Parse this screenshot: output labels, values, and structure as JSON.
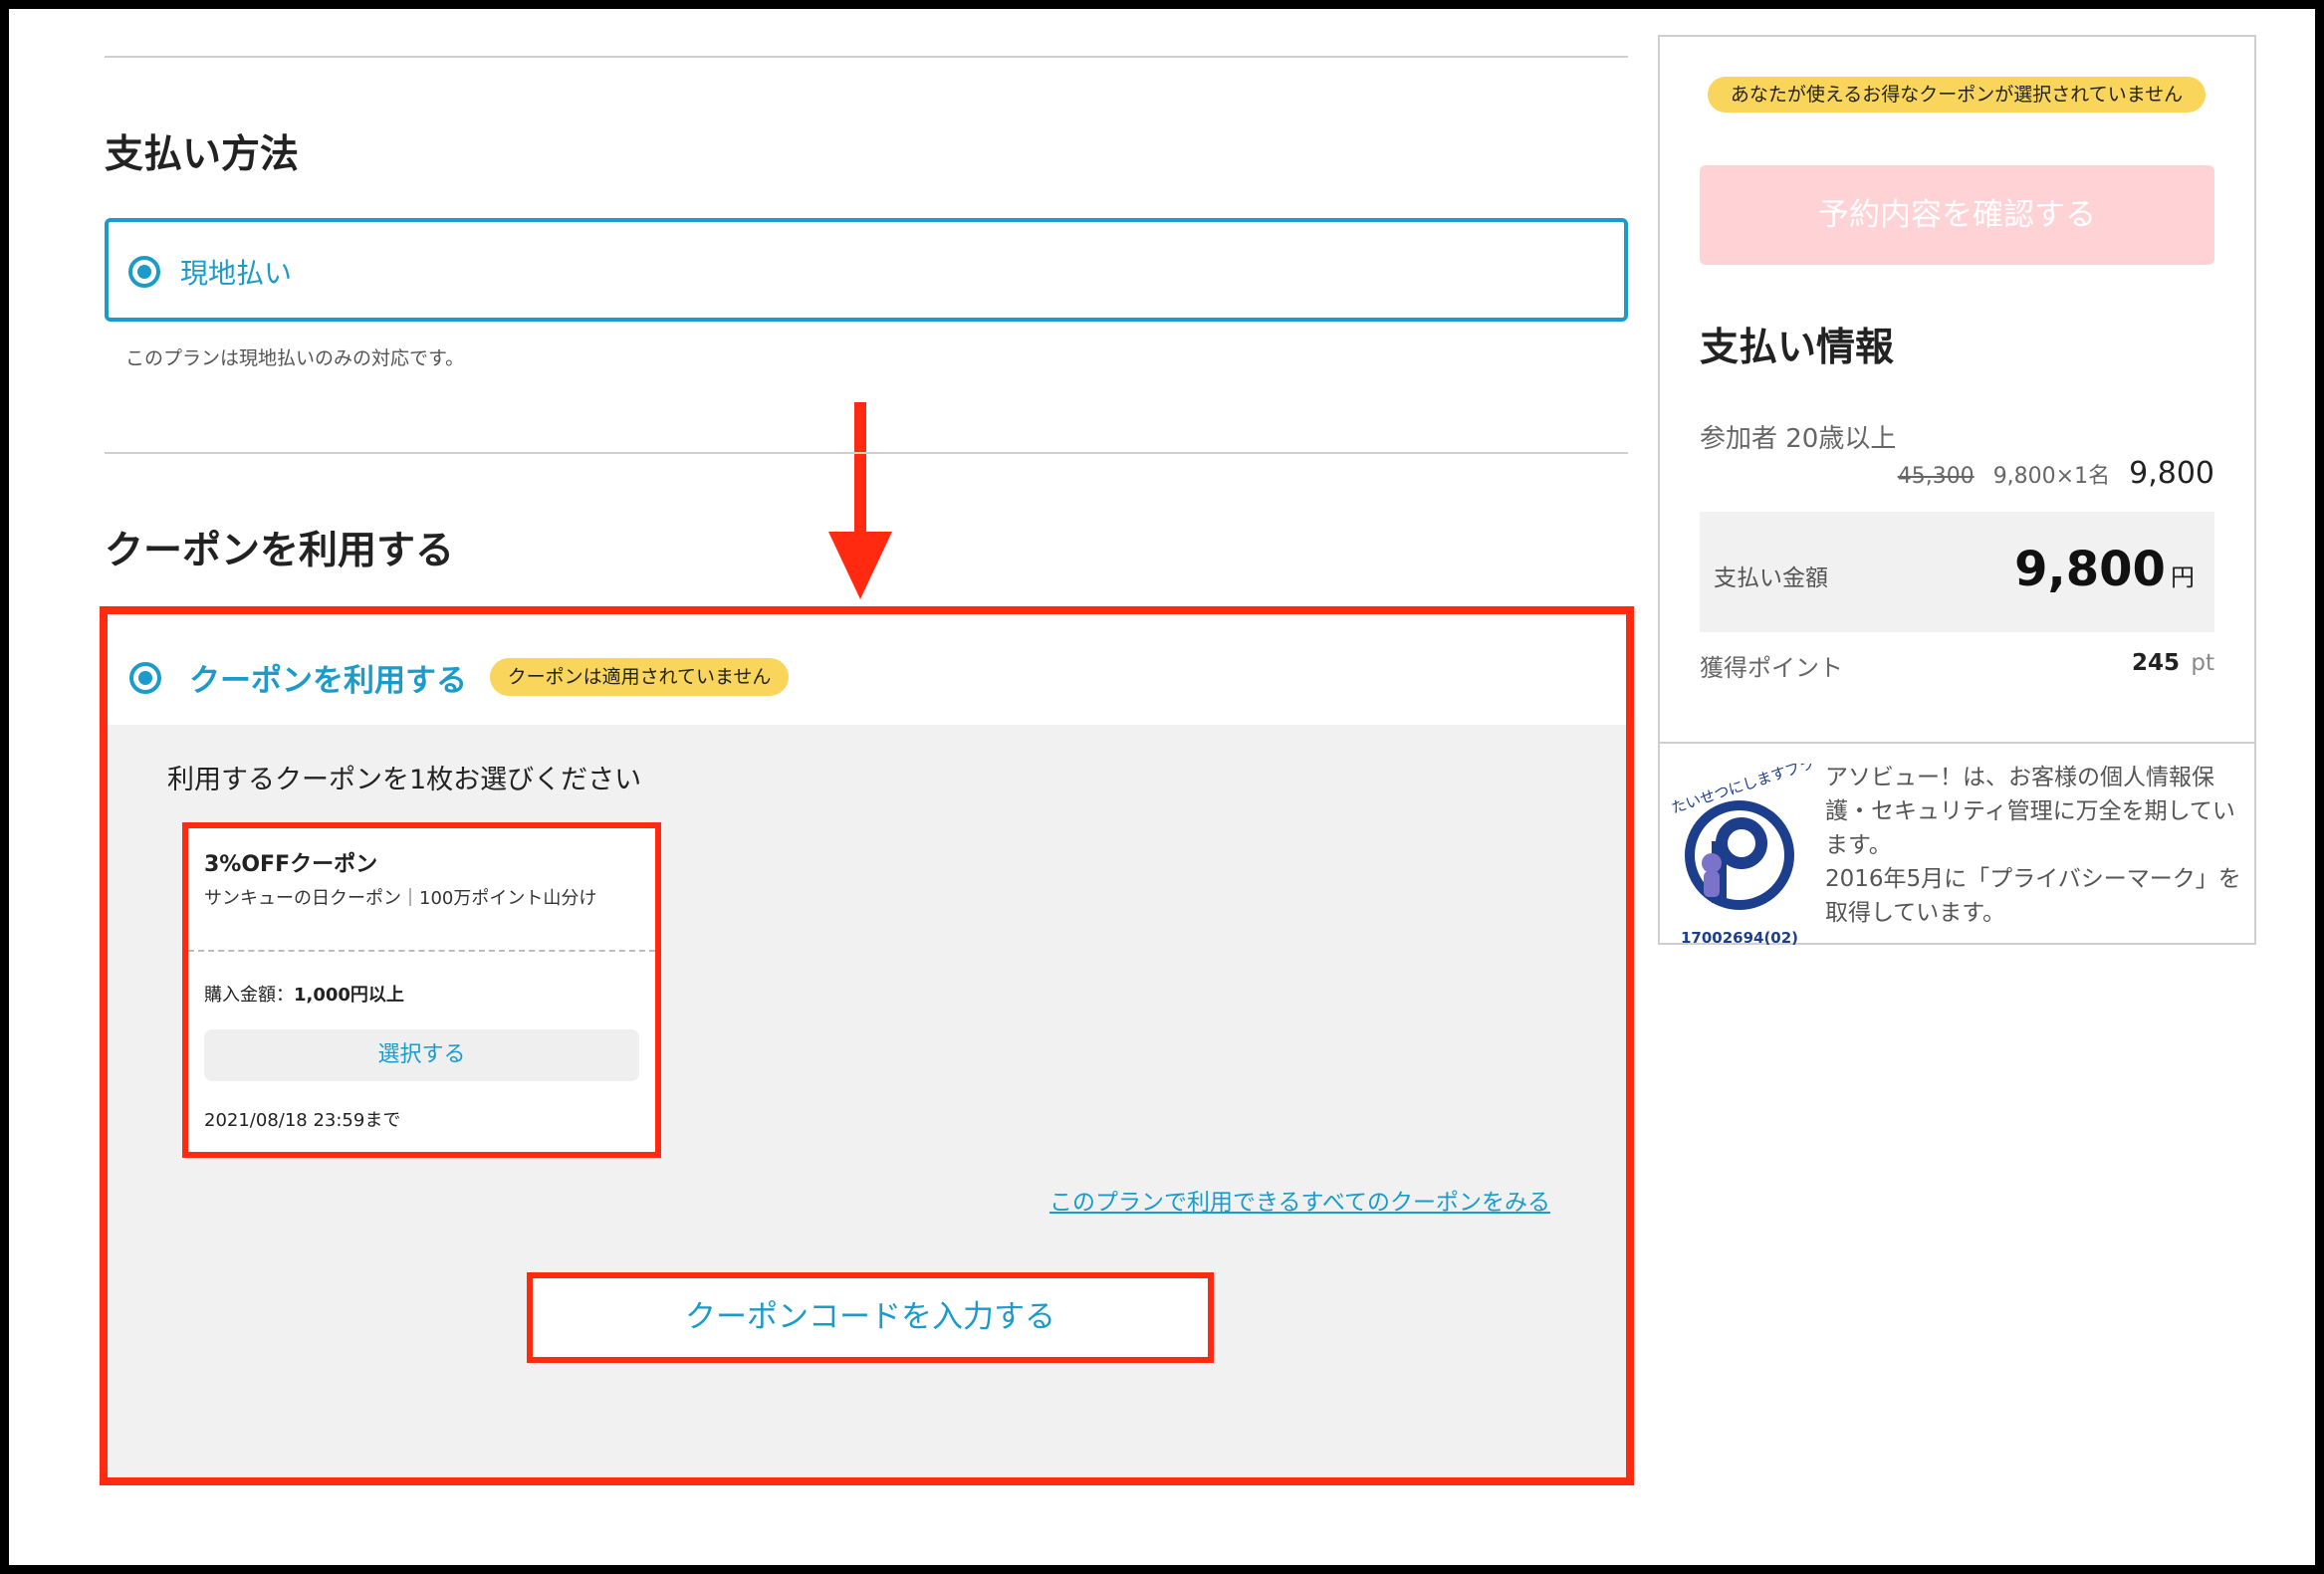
{
  "payment": {
    "section_title": "支払い方法",
    "option_label": "現地払い",
    "note": "このプランは現地払いのみの対応です。"
  },
  "coupon": {
    "section_title": "クーポンを利用する",
    "option_label": "クーポンを利用する",
    "status_badge": "クーポンは適用されていません",
    "instruction": "利用するクーポンを1枚お選びください",
    "card": {
      "title": "3%OFFクーポン",
      "subtitle": "サンキューの日クーポン｜100万ポイント山分け",
      "condition_label": "購入金額：",
      "condition_value": "1,000円以上",
      "select_button": "選択する",
      "expiry": "2021/08/18 23:59まで"
    },
    "view_all_link": "このプランで利用できるすべてのクーポンをみる",
    "enter_code_button": "クーポンコードを入力する"
  },
  "sidebar": {
    "coupon_notice": "あなたが使えるお得なクーポンが選択されていません",
    "confirm_button": "予約内容を確認する",
    "info_title": "支払い情報",
    "participant_label": "参加者 20歳以上",
    "original_price": "45,300",
    "unit_calc": "9,800×1名",
    "line_total": "9,800",
    "total_label": "支払い金額",
    "total_value": "9,800",
    "total_unit": "円",
    "points_label": "獲得ポイント",
    "points_value": "245",
    "points_unit": "pt",
    "privacy_text_1": "アソビュー！は、お客様の個人情報保護・セキュリティ管理に万全を期しています。",
    "privacy_text_2": "2016年5月に「プライバシーマーク」を取得しています。",
    "privacy_mark_arc_text": "たいせつにしますプライバシー",
    "privacy_mark_number": "17002694(02)"
  },
  "colors": {
    "accent_blue": "#1a9bc9",
    "highlight_red": "#ff2a0f",
    "badge_yellow": "#f9d55b",
    "disabled_pink": "#ffd3d6"
  }
}
